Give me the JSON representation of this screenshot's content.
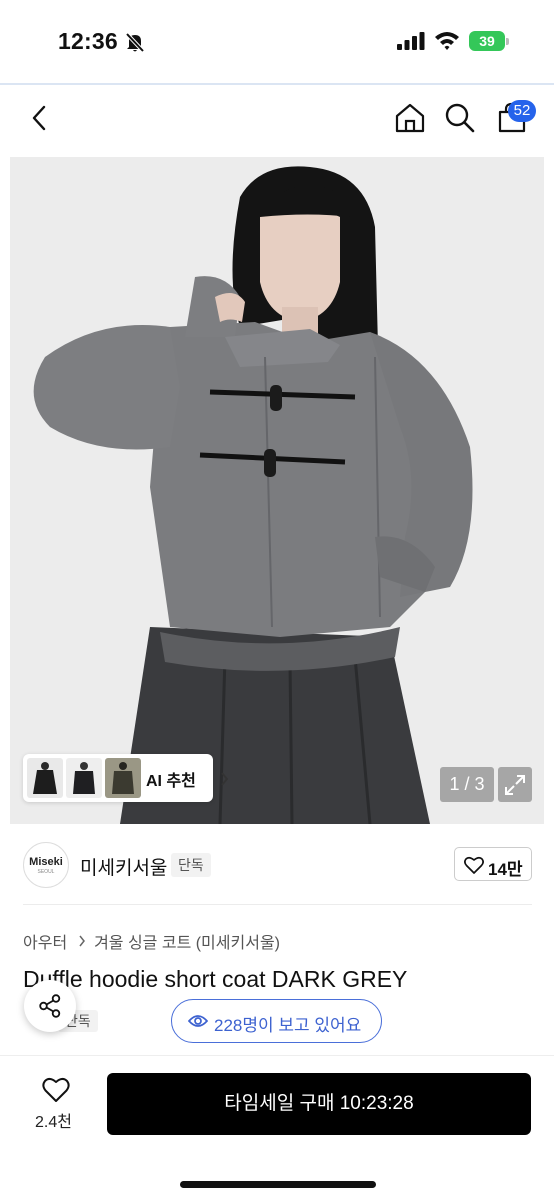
{
  "status_bar": {
    "time": "12:36",
    "battery": "39"
  },
  "nav": {
    "cart_count": "52"
  },
  "gallery": {
    "ai_label": "AI 추천",
    "page_counter": "1 / 3"
  },
  "seller": {
    "logo_text": "Miseki",
    "logo_sub": "SEOUL",
    "name": "미세키서울",
    "tag": "단독",
    "like_count": "14만"
  },
  "breadcrumb": {
    "category": "아우터",
    "subcategory": "겨울 싱글 코트 (미세키서울)"
  },
  "product": {
    "title": "Duffle hoodie short coat DARK GREY",
    "exclusive_tag": "단독",
    "viewers_text": "228명이 보고 있어요"
  },
  "bottom_bar": {
    "wish_count": "2.4천",
    "buy_label": "타임세일 구매 10:23:28"
  },
  "colors": {
    "accent_blue": "#2563eb",
    "viewers_blue": "#3d62d0",
    "battery_green": "#34c759",
    "buy_button": "#000000"
  }
}
